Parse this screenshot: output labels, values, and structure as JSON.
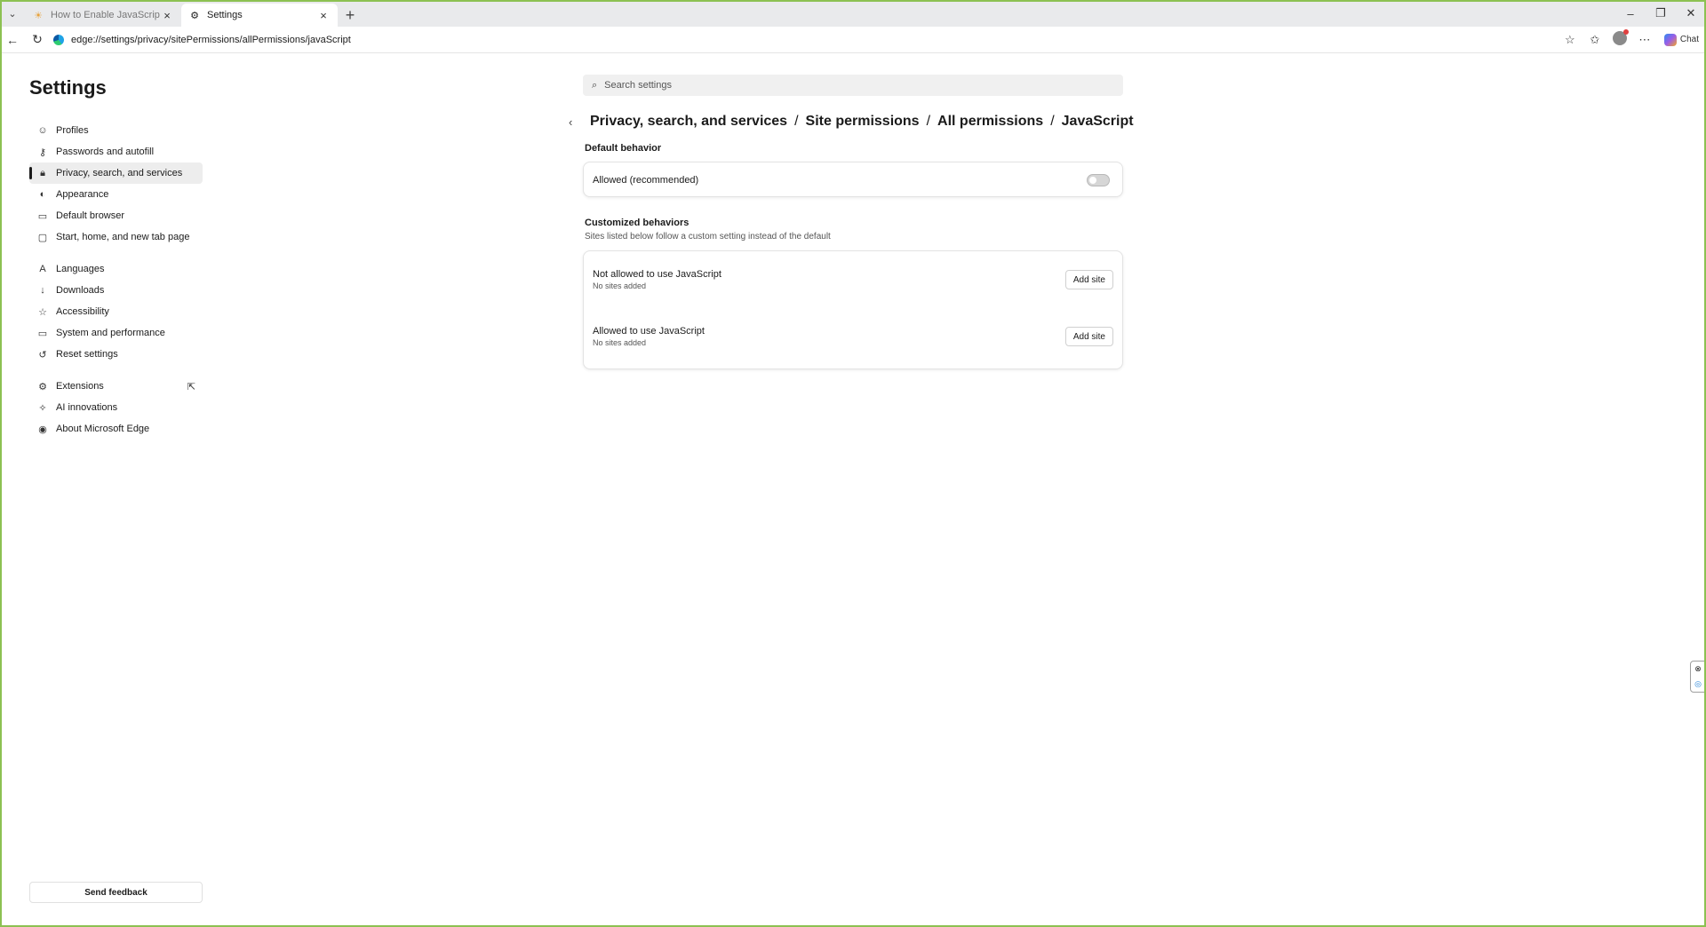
{
  "browser": {
    "tabs": [
      {
        "title": "How to Enable JavaScript in All Ty",
        "active": false,
        "icon": "sun-favicon-icon"
      },
      {
        "title": "Settings",
        "active": true,
        "icon": "gear-icon"
      }
    ],
    "address": "edge://settings/privacy/sitePermissions/allPermissions/javaScript",
    "chat_label": "Chat"
  },
  "sidebar": {
    "title": "Settings",
    "groups": [
      [
        {
          "label": "Profiles",
          "icon": "profile-icon"
        },
        {
          "label": "Passwords and autofill",
          "icon": "key-icon"
        },
        {
          "label": "Privacy, search, and services",
          "icon": "lock-icon",
          "selected": true
        },
        {
          "label": "Appearance",
          "icon": "palette-icon"
        },
        {
          "label": "Default browser",
          "icon": "browser-icon"
        },
        {
          "label": "Start, home, and new tab page",
          "icon": "home-icon"
        }
      ],
      [
        {
          "label": "Languages",
          "icon": "language-icon"
        },
        {
          "label": "Downloads",
          "icon": "download-icon"
        },
        {
          "label": "Accessibility",
          "icon": "accessibility-icon"
        },
        {
          "label": "System and performance",
          "icon": "laptop-icon"
        },
        {
          "label": "Reset settings",
          "icon": "reset-icon"
        }
      ],
      [
        {
          "label": "Extensions",
          "icon": "extensions-icon"
        },
        {
          "label": "AI innovations",
          "icon": "ai-icon"
        },
        {
          "label": "About Microsoft Edge",
          "icon": "edge-icon"
        }
      ]
    ],
    "feedback_label": "Send feedback"
  },
  "main": {
    "search_placeholder": "Search settings",
    "breadcrumb": [
      "Privacy, search, and services",
      "Site permissions",
      "All permissions",
      "JavaScript"
    ],
    "default_behavior": {
      "title": "Default behavior",
      "label": "Allowed (recommended)",
      "enabled": false
    },
    "customized": {
      "title": "Customized behaviors",
      "subtitle": "Sites listed below follow a custom setting instead of the default",
      "rows": [
        {
          "label": "Not allowed to use JavaScript",
          "sub": "No sites added",
          "button": "Add site"
        },
        {
          "label": "Allowed to use JavaScript",
          "sub": "No sites added",
          "button": "Add site"
        }
      ]
    }
  },
  "colors": {
    "frame": "#8cc152",
    "selected_bg": "#ededed"
  }
}
